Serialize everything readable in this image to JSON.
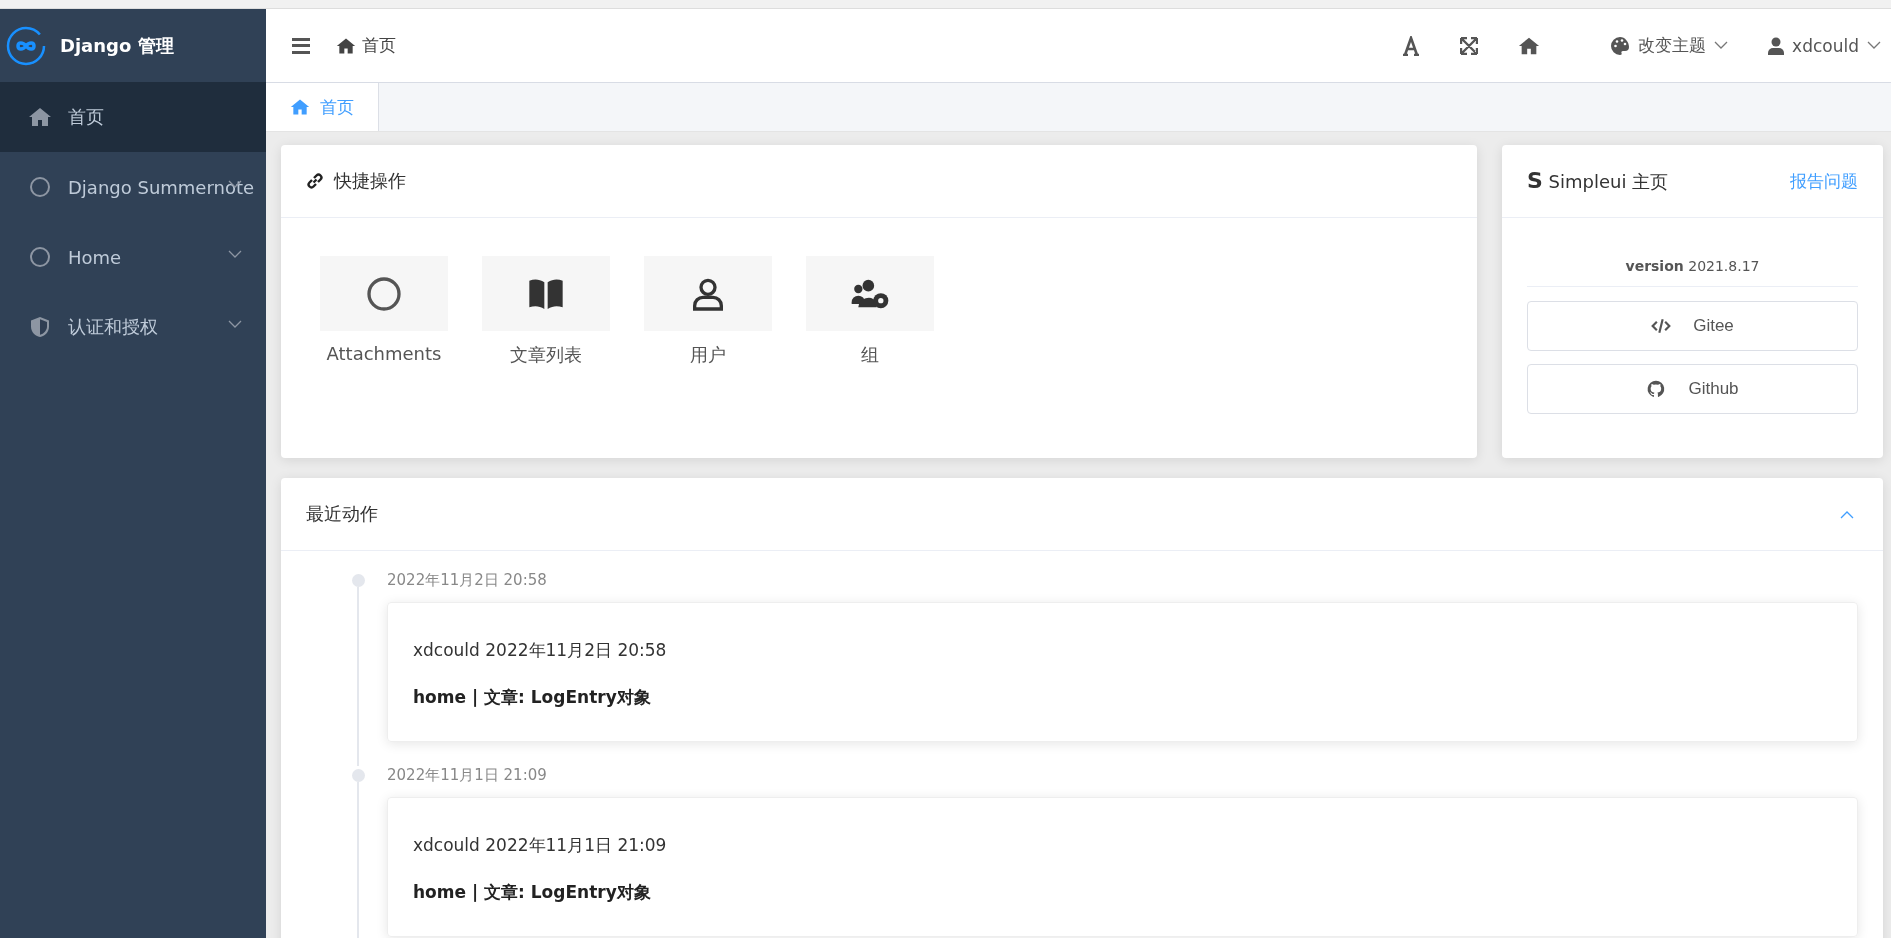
{
  "sidebar": {
    "logo_title": "Django 管理",
    "items": [
      {
        "label": "首页",
        "kind": "home",
        "selected": true,
        "expandable": false
      },
      {
        "label": "Django Summernote",
        "kind": "circle",
        "selected": false,
        "expandable": true
      },
      {
        "label": "Home",
        "kind": "circle",
        "selected": false,
        "expandable": true
      },
      {
        "label": "认证和授权",
        "kind": "shield",
        "selected": false,
        "expandable": true
      }
    ]
  },
  "topbar": {
    "breadcrumb": "首页",
    "theme_label": "改变主题",
    "user": "xdcould"
  },
  "tabs": [
    {
      "label": "首页",
      "selected": true
    }
  ],
  "quick_actions": {
    "title": "快捷操作",
    "items": [
      {
        "label": "Attachments",
        "kind": "circle"
      },
      {
        "label": "文章列表",
        "kind": "book"
      },
      {
        "label": "用户",
        "kind": "user"
      },
      {
        "label": "组",
        "kind": "users-gear"
      }
    ]
  },
  "simpleui": {
    "logo_letter": "S",
    "title": "Simpleui 主页",
    "report_link": "报告问题",
    "version_label": "version",
    "version": "2021.8.17",
    "buttons": [
      {
        "label": "Gitee",
        "kind": "code"
      },
      {
        "label": "Github",
        "kind": "github"
      }
    ]
  },
  "recent_actions": {
    "title": "最近动作",
    "expanded": true,
    "entries": [
      {
        "timestamp": "2022年11月2日 20:58",
        "line": "xdcould 2022年11月2日 20:58",
        "detail": "home | 文章: LogEntry对象"
      },
      {
        "timestamp": "2022年11月1日 21:09",
        "line": "xdcould 2022年11月1日 21:09",
        "detail": "home | 文章: LogEntry对象"
      }
    ]
  }
}
